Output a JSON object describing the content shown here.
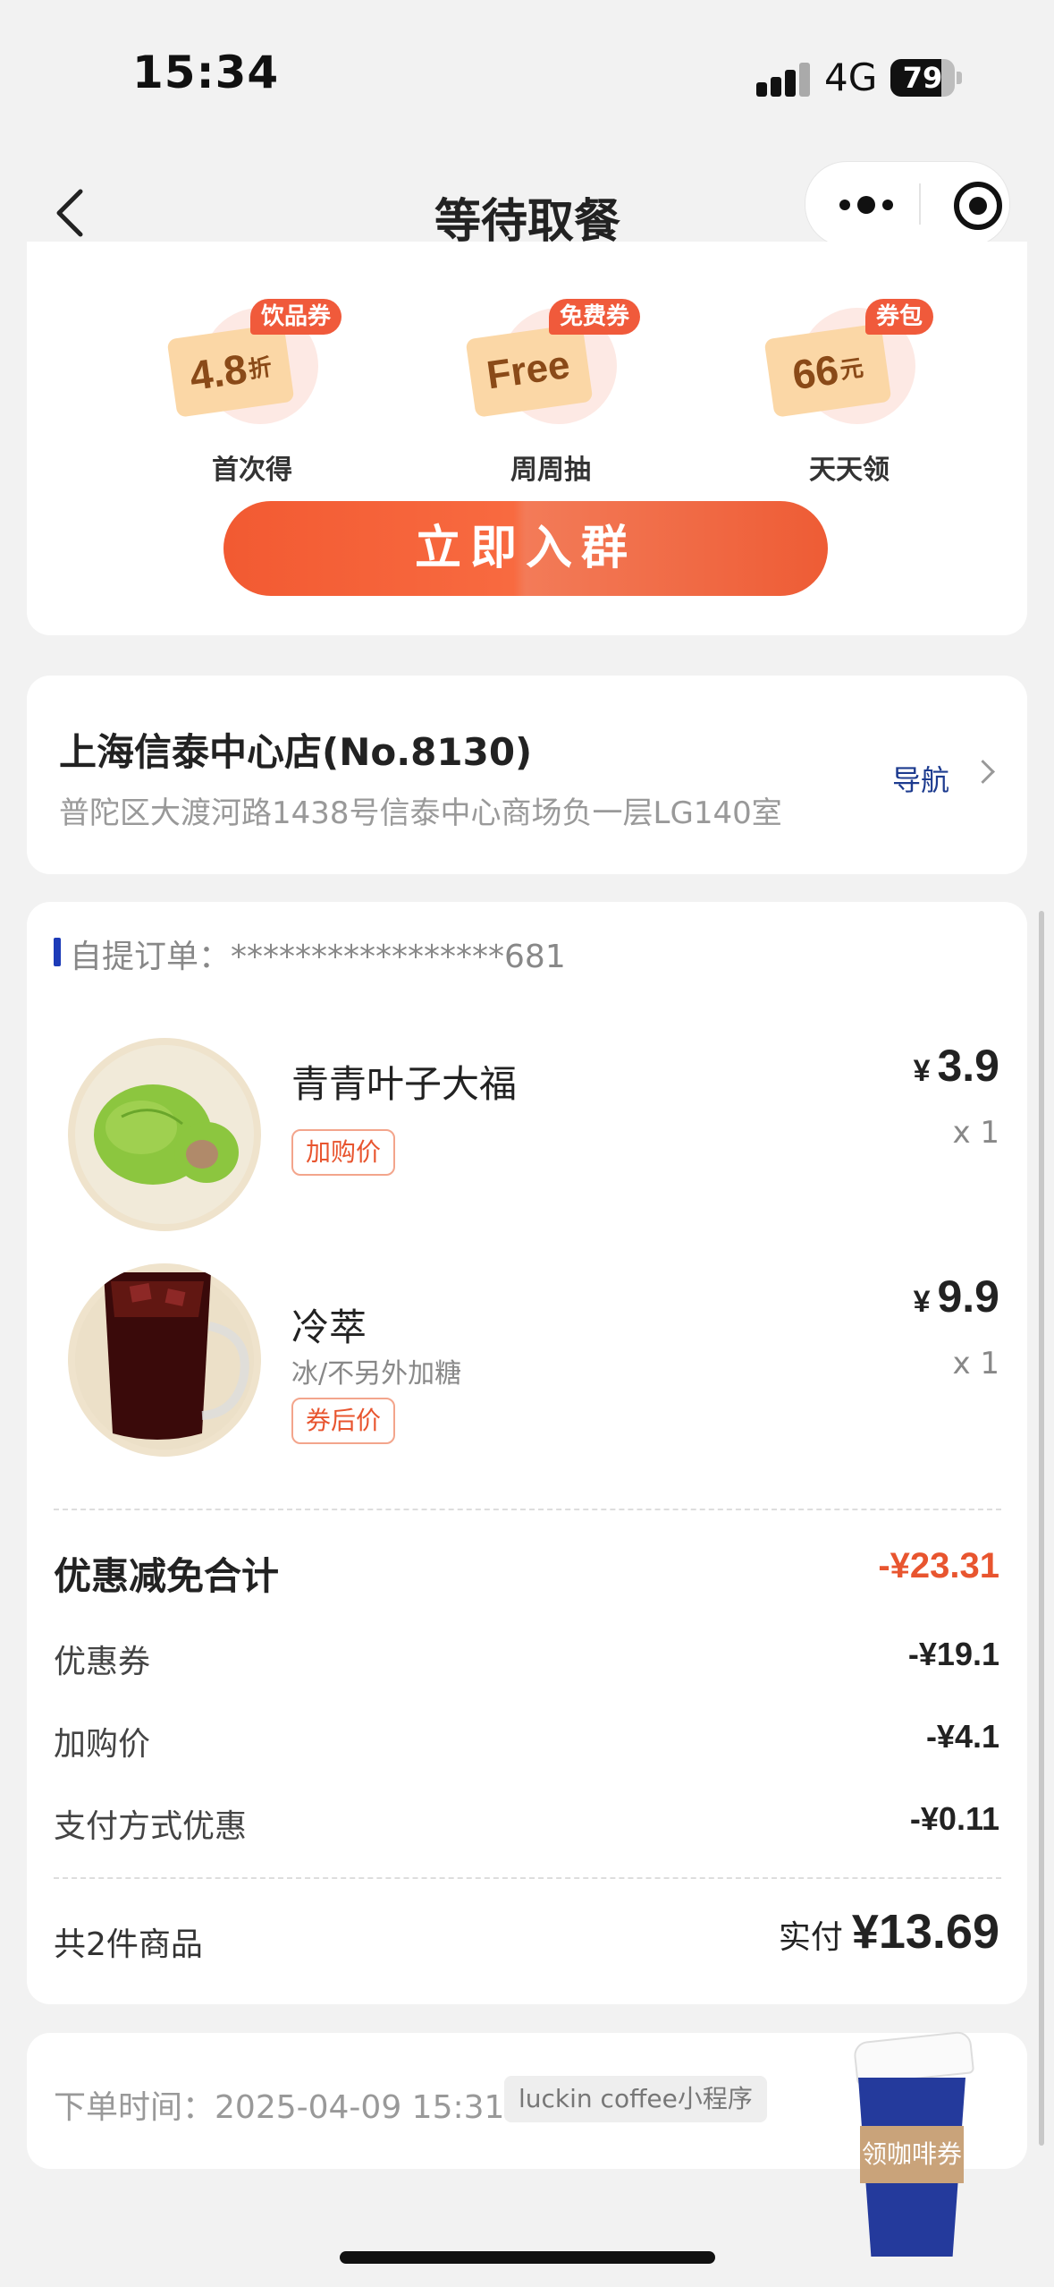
{
  "status_bar": {
    "time": "15:34",
    "network": "4G",
    "battery": "79",
    "battery_level": 0.79
  },
  "nav": {
    "title": "等待取餐"
  },
  "promo": {
    "coupons": [
      {
        "tag": "饮品券",
        "value": "4.8",
        "unit": "折",
        "caption": "首次得"
      },
      {
        "tag": "免费券",
        "value": "Free",
        "unit": "",
        "caption": "周周抽"
      },
      {
        "tag": "券包",
        "value": "66",
        "unit": "元",
        "caption": "天天领"
      }
    ],
    "join_button": "立即入群"
  },
  "store": {
    "name": "上海信泰中心店(No.8130)",
    "address": "普陀区大渡河路1438号信泰中心商场负一层LG140室",
    "nav_label": "导航"
  },
  "order": {
    "order_label": "自提订单：",
    "order_number": "*****************681",
    "items": [
      {
        "name": "青青叶子大福",
        "spec": "",
        "badge": "加购价",
        "currency": "¥",
        "price": "3.9",
        "qty": "x 1"
      },
      {
        "name": "冷萃",
        "spec": "冰/不另外加糖",
        "badge": "券后价",
        "currency": "¥",
        "price": "9.9",
        "qty": "x 1"
      }
    ],
    "discount_total_label": "优惠减免合计",
    "discount_total": "-¥23.31",
    "discounts": [
      {
        "label": "优惠券",
        "value": "-¥19.1"
      },
      {
        "label": "加购价",
        "value": "-¥4.1"
      },
      {
        "label": "支付方式优惠",
        "value": "-¥0.11"
      }
    ],
    "count_label": "共2件商品",
    "paid_label": "实付",
    "paid_amount": "¥13.69"
  },
  "order_time": {
    "label": "下单时间：",
    "value": "2025-04-09 15:31",
    "source": "luckin coffee小程序"
  },
  "floating": {
    "coffee_coupon": "领咖啡券"
  },
  "colors": {
    "accent": "#f05a3b",
    "nav_blue": "#1d3b8f",
    "brand_blue": "#243a9c"
  }
}
